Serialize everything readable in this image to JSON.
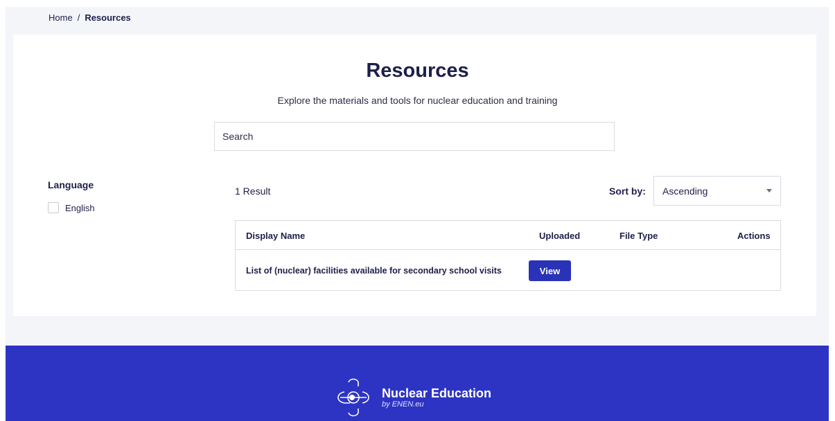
{
  "breadcrumb": {
    "home": "Home",
    "separator": "/",
    "current": "Resources"
  },
  "page": {
    "title": "Resources",
    "subtitle": "Explore the materials and tools for nuclear education and training"
  },
  "search": {
    "placeholder": "Search",
    "value": ""
  },
  "filters": {
    "title": "Language",
    "options": [
      {
        "label": "English",
        "checked": false
      }
    ]
  },
  "results": {
    "count_label": "1 Result"
  },
  "sort": {
    "label": "Sort by:",
    "selected": "Ascending"
  },
  "table": {
    "headers": {
      "display_name": "Display Name",
      "uploaded": "Uploaded",
      "file_type": "File Type",
      "actions": "Actions"
    },
    "rows": [
      {
        "display_name": "List of (nuclear) facilities available for secondary school visits",
        "uploaded": "",
        "file_type": "",
        "action_label": "View"
      }
    ]
  },
  "footer": {
    "logo_name": "Nuclear Education",
    "logo_tagline": "by ENEN.eu"
  },
  "colors": {
    "accent": "#2d34c4",
    "button": "#2a33b8",
    "text": "#1d1f4a",
    "page_bg": "#f4f5f9"
  },
  "icons": {
    "caret": "chevron-down-icon",
    "logo": "atom-logo-icon"
  }
}
